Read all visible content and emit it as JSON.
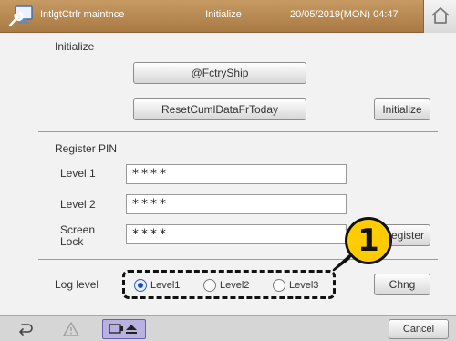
{
  "header": {
    "app_name": "IntlgtCtrlr maintnce",
    "title": "Initialize",
    "datetime": "20/05/2019(MON) 04:47",
    "home_icon": "home-icon",
    "app_icon": "wrench-monitor-icon",
    "accent_color": "#b48550"
  },
  "initialize": {
    "section_title": "Initialize",
    "factory_ship_label": "@FctryShip",
    "reset_cum_label": "ResetCumlDataFrToday",
    "initialize_label": "Initialize"
  },
  "register_pin": {
    "section_title": "Register PIN",
    "level1_label": "Level 1",
    "level1_value": "****",
    "level2_label": "Level 2",
    "level2_value": "****",
    "screen_lock_label_1": "Screen",
    "screen_lock_label_2": "Lock",
    "screen_lock_value": "****",
    "register_label": "Register"
  },
  "log_level": {
    "label": "Log level",
    "options": [
      "Level1",
      "Level2",
      "Level3"
    ],
    "selected": "Level1",
    "change_label": "Chng"
  },
  "callout": {
    "number": "1",
    "color": "#ffcc00"
  },
  "footer": {
    "back_icon": "back-arrow-icon",
    "warning_icon": "warning-icon",
    "media_icon": "eject-media-icon",
    "cancel_label": "Cancel"
  }
}
